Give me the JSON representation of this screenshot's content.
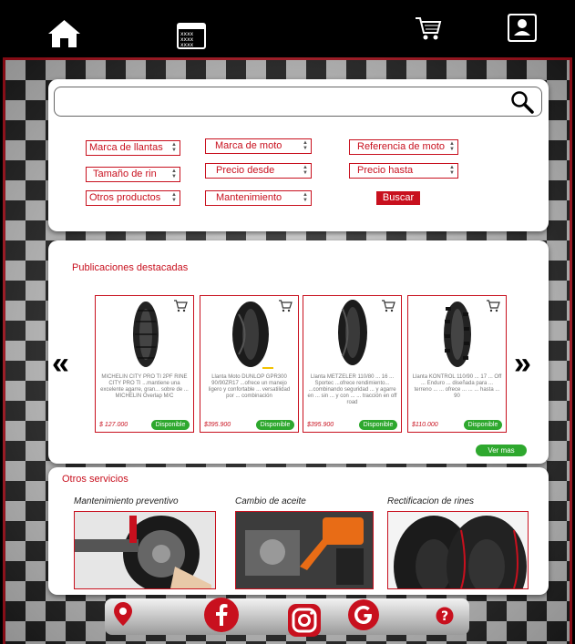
{
  "header": {
    "icons": [
      "home-icon",
      "calendar-icon",
      "cart-icon",
      "user-icon"
    ]
  },
  "search": {
    "placeholder": ""
  },
  "filters": {
    "marca_llantas": "Marca de llantas",
    "marca_moto": "Marca de moto",
    "referencia_moto": "Referencia de moto",
    "tamano_rin": "Tamaño de rin",
    "precio_desde": "Precio desde",
    "precio_hasta": "Precio hasta",
    "otros_productos": "Otros productos",
    "mantenimiento": "Mantenimiento",
    "buscar": "Buscar"
  },
  "featured": {
    "title": "Publicaciones destacadas",
    "prev": "«",
    "next": "»",
    "cards": [
      {
        "desc": "MICHELIN CITY PRO TI 2PF RINE CITY PRO TI ...mantiene una excelente agarre, gran... sobre de ... MICHELIN Overlap M/C",
        "price": "$ 127.000",
        "status": "Disponible"
      },
      {
        "desc": "Llanta Moto DUNLOP GPR300 90/90ZR17 ...ofrece un manejo ligero y confortable ... versatilidad por ... combinación",
        "price": "$395.900",
        "status": "Disponible"
      },
      {
        "desc": "Llanta METZELER 110/80 ... 16 ... Sportec ...ofrece rendimiento... ...combinando seguridad ... y agarre en ... sin ... y con ... ... tracción en off road",
        "price": "$395.900",
        "status": "Disponible"
      },
      {
        "desc": "Llanta KONTROL 110/90 ... 17 ... Off ... Enduro ... diseñada para ... terreno ... ... ofrece ... ... ... hasta ... 90",
        "price": "$110.000",
        "status": "Disponible"
      }
    ],
    "ver_mas": "Ver mas"
  },
  "services": {
    "title": "Otros servicios",
    "items": [
      {
        "label": "Mantenimiento preventivo"
      },
      {
        "label": "Cambio de aceite"
      },
      {
        "label": "Rectificacion de rines"
      }
    ]
  },
  "footer": {
    "icons": [
      "location-icon",
      "facebook-icon",
      "instagram-icon",
      "google-icon",
      "help-icon"
    ]
  },
  "colors": {
    "accent": "#c8101e",
    "available": "#2ea82e"
  }
}
